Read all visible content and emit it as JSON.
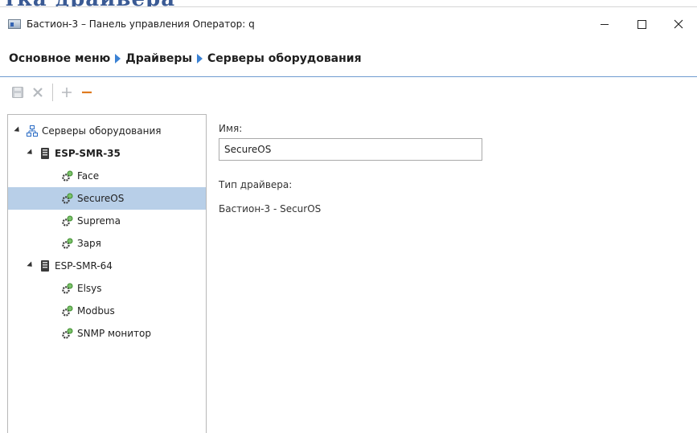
{
  "window": {
    "title": "Бастион-3 – Панель управления Оператор: q",
    "bg_text": "тка драйвера"
  },
  "breadcrumb": [
    "Основное меню",
    "Драйверы",
    "Серверы оборудования"
  ],
  "toolbar": {
    "icons": [
      "save-icon",
      "delete-icon",
      "add-icon",
      "remove-icon"
    ],
    "accent_remove": "#e07a1f"
  },
  "tree": {
    "root": "Серверы оборудования",
    "servers": [
      {
        "name": "ESP-SMR-35",
        "bold": true,
        "drivers": [
          "Face",
          "SecureOS",
          "Suprema",
          "Заря"
        ]
      },
      {
        "name": "ESP-SMR-64",
        "bold": false,
        "drivers": [
          "Elsys",
          "Modbus",
          "SNMP монитор"
        ]
      }
    ],
    "selected": "SecureOS",
    "selection_color": "#b8cfe8"
  },
  "details": {
    "name_label": "Имя:",
    "name_value": "SecureOS",
    "type_label": "Тип драйвера:",
    "type_value": "Бастион-3 - SecurOS"
  }
}
